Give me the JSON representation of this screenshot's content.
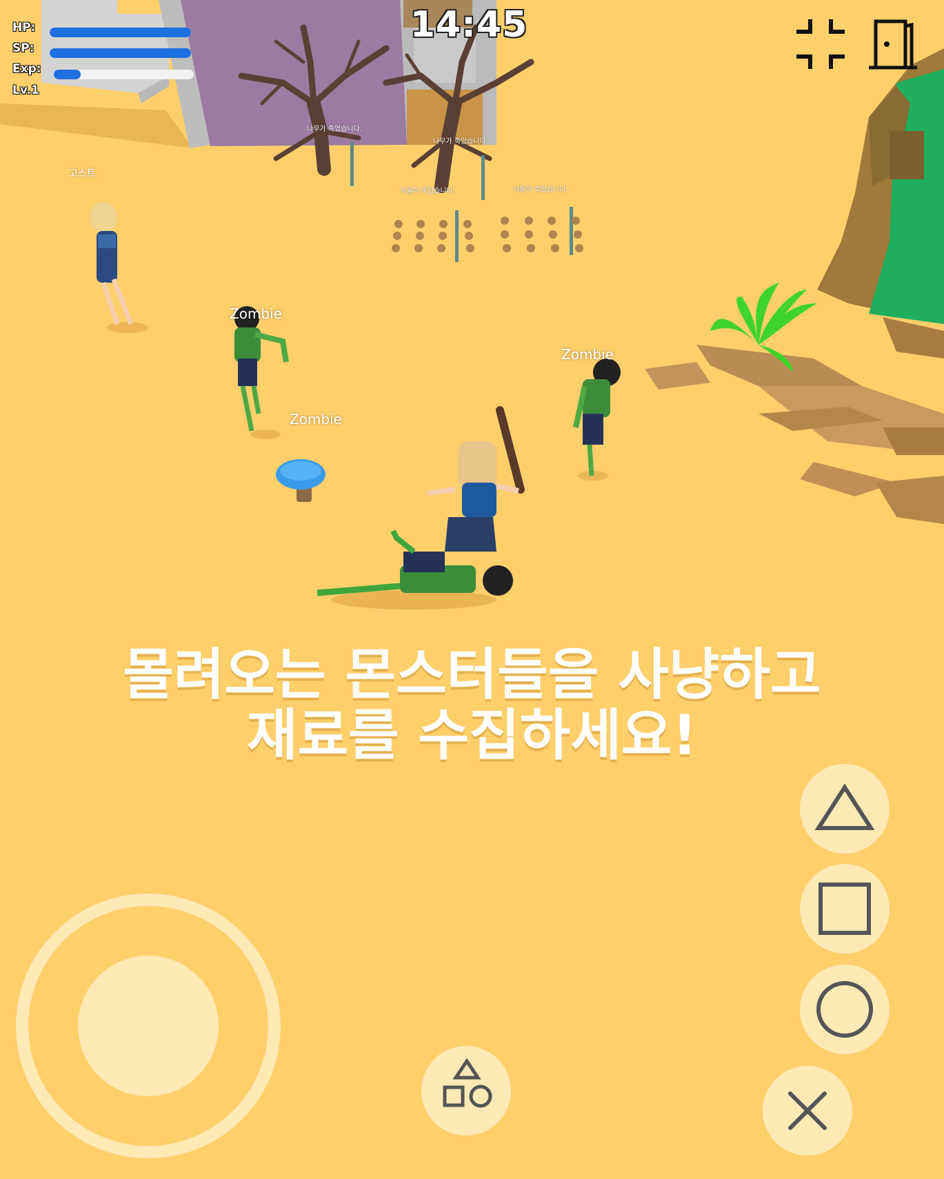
{
  "hud": {
    "hp_label": "HP:",
    "sp_label": "SP:",
    "exp_label": "Exp:",
    "level_label": "Lv.1",
    "hp_fraction": 1.0,
    "sp_fraction": 1.0,
    "exp_fraction": 0.19,
    "clock": "14:45"
  },
  "nameplates": {
    "ghost": "고스트",
    "zombie_1": "Zombie",
    "zombie_2": "Zombie",
    "zombie_3": "Zombie"
  },
  "world_notices": {
    "tree_1": "나무가 죽었습니다.",
    "tree_2": "나무가 죽었습니다.",
    "plant_1": "식물이 죽었습니다.",
    "plant_2": "식물이 죽었습니다."
  },
  "caption": {
    "line1": "몰려오는 몬스터들을 사냥하고",
    "line2": "재료를 수집하세요!"
  },
  "controls": {
    "fullscreen_icon": "fullscreen-corners-icon",
    "exit_icon": "exit-door-icon",
    "triangle_icon": "triangle-icon",
    "square_icon": "square-icon",
    "circle_icon": "circle-icon",
    "cross_icon": "cross-icon",
    "skill_icon": "shapes-menu-icon"
  },
  "colors": {
    "background": "#ffcf6b",
    "bar_fill": "#1e6fe0",
    "button_bg": "#ffe9b5",
    "icon_stroke": "#555555"
  }
}
